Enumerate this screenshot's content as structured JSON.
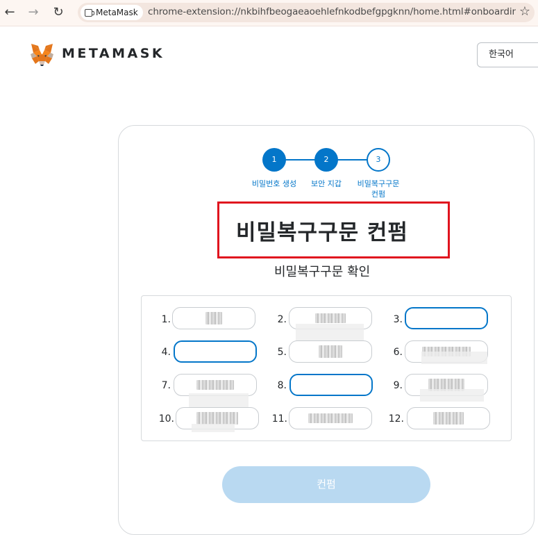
{
  "browser": {
    "back_icon": "arrow-left-icon",
    "forward_icon": "arrow-right-icon",
    "reload_icon": "reload-icon",
    "site_chip": "MetaMask",
    "url": "chrome-extension://nkbihfbeogaeaoehlefnkodbefgpgknn/home.html#onboardin...",
    "bookmark_icon": "star-icon"
  },
  "header": {
    "wordmark": "METAMASK",
    "language": "한국어"
  },
  "stepper": {
    "steps": [
      {
        "number": "1",
        "label": "비밀번호 생성",
        "state": "done"
      },
      {
        "number": "2",
        "label": "보안 지갑",
        "state": "done"
      },
      {
        "number": "3",
        "label_line1": "비밀복구구문",
        "label_line2": "컨펌",
        "state": "current"
      }
    ]
  },
  "main": {
    "title": "비밀복구구문 컨펌",
    "subtitle": "비밀복구구문 확인",
    "confirm_label": "컨펌"
  },
  "words": [
    {
      "n": "1.",
      "value": "",
      "masked": true
    },
    {
      "n": "2.",
      "value": "",
      "masked": true
    },
    {
      "n": "3.",
      "value": "",
      "masked": false
    },
    {
      "n": "4.",
      "value": "",
      "masked": false
    },
    {
      "n": "5.",
      "value": "",
      "masked": true
    },
    {
      "n": "6.",
      "value": "",
      "masked": true
    },
    {
      "n": "7.",
      "value": "",
      "masked": true
    },
    {
      "n": "8.",
      "value": "",
      "masked": false
    },
    {
      "n": "9.",
      "value": "",
      "masked": true
    },
    {
      "n": "10.",
      "value": "",
      "masked": true
    },
    {
      "n": "11.",
      "value": "",
      "masked": true
    },
    {
      "n": "12.",
      "value": "",
      "masked": true
    }
  ],
  "colors": {
    "accent": "#0376c9",
    "highlight": "#e0141e",
    "button_disabled": "#b9d9f1"
  }
}
